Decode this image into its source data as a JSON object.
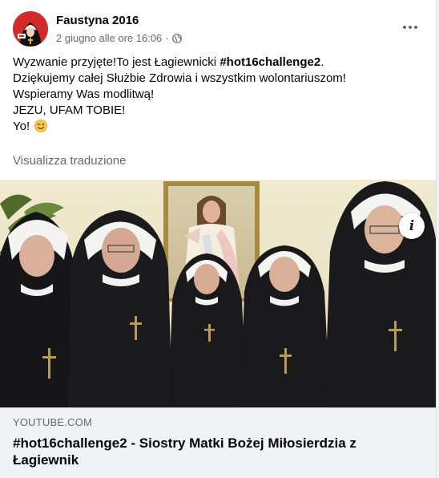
{
  "post": {
    "author": "Faustyna 2016",
    "timestamp": "2 giugno alle ore 16:06",
    "separator": "·",
    "privacy_icon": "globe-icon",
    "more_icon": "more-options-icon",
    "text_lines": [
      {
        "before": "Wyzwanie przyjęte!To jest Łagiewnicki ",
        "bold": "#hot16challenge2",
        "after": "."
      },
      {
        "before": "Dziękujemy całej Służbie Zdrowia i wszystkim wolontariuszom!",
        "bold": "",
        "after": ""
      },
      {
        "before": "Wspieramy Was modlitwą!",
        "bold": "",
        "after": ""
      },
      {
        "before": "JEZU, UFAM TOBIE!",
        "bold": "",
        "after": ""
      },
      {
        "before": "Yo!",
        "bold": "",
        "after": ""
      }
    ],
    "emoji": "winking-face-emoji",
    "see_translation": "Visualizza traduzione"
  },
  "link_preview": {
    "domain": "YOUTUBE.COM",
    "title": "#hot16challenge2 - Siostry Matki Bożej Miłosierdzia z Łagiewnik",
    "info_icon": "info-icon",
    "info_glyph": "i"
  },
  "colors": {
    "text": "#050505",
    "secondary": "#65676b",
    "link_bg": "#f0f2f5",
    "avatar_red": "#d32a2a"
  }
}
